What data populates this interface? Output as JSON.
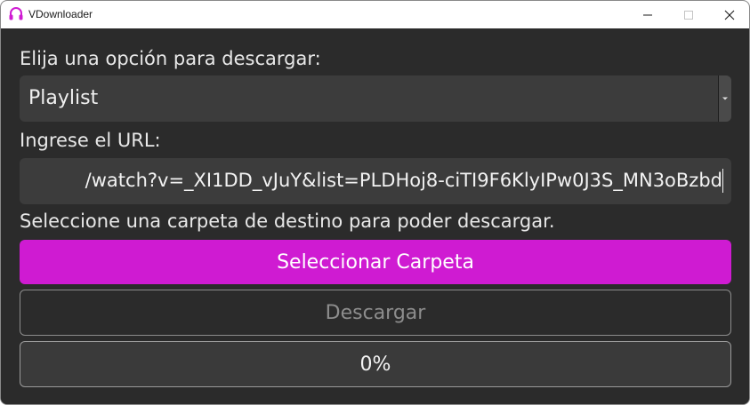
{
  "window": {
    "title": "VDownloader",
    "icon": "headphones-icon",
    "accent": "#cf1bd2"
  },
  "main": {
    "option_label": "Elija una opción para descargar:",
    "option_selected": "Playlist",
    "url_label": "Ingrese el URL:",
    "url_value": "/watch?v=_XI1DD_vJuY&list=PLDHoj8-ciTI9F6KlyIPw0J3S_MN3oBzbd",
    "folder_label": "Seleccione una carpeta de destino para poder descargar.",
    "select_folder_button": "Seleccionar Carpeta",
    "download_button": "Descargar",
    "progress_text": "0%",
    "progress_value": 0
  }
}
